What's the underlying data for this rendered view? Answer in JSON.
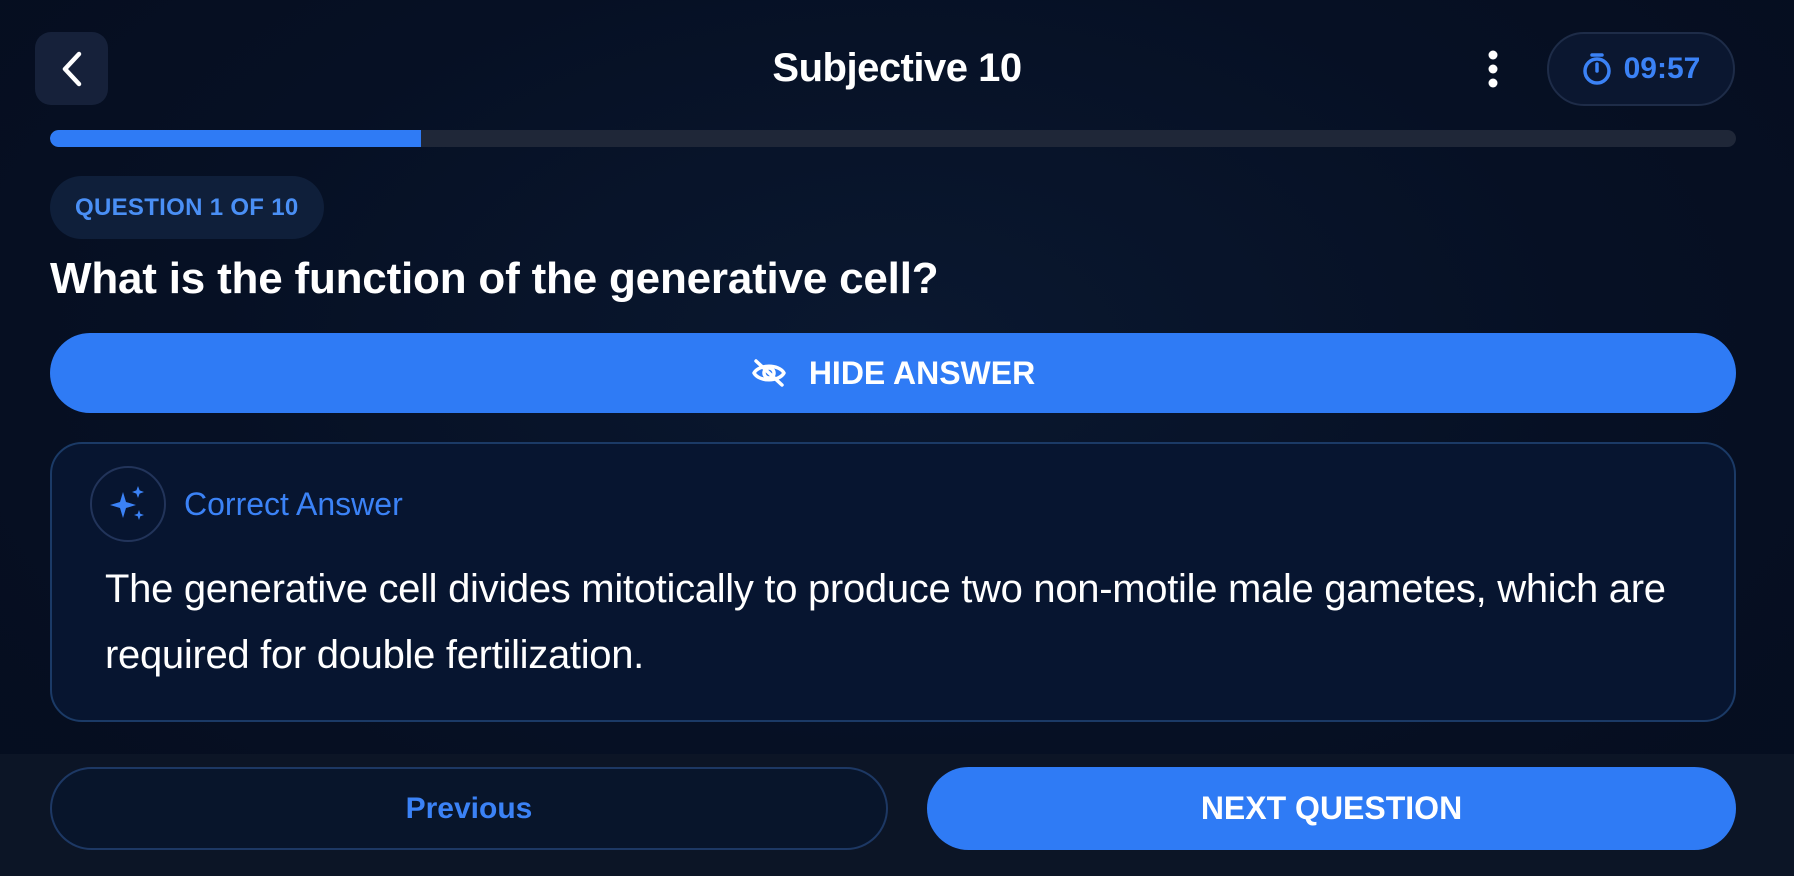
{
  "header": {
    "title": "Subjective 10",
    "timer": "09:57",
    "back_icon": "chevron-left-icon",
    "more_icon": "more-vertical-icon",
    "timer_icon": "stopwatch-icon"
  },
  "progress": {
    "fraction": 0.22
  },
  "question": {
    "badge": "QUESTION 1 OF 10",
    "text": "What is the function of the generative cell?"
  },
  "hide_answer": {
    "label": "HIDE ANSWER",
    "icon": "eye-off-icon"
  },
  "answer": {
    "label": "Correct Answer",
    "icon": "sparkles-icon",
    "text": "The generative cell divides mitotically to produce two non-motile male gametes, which are required for double fertilization."
  },
  "footer": {
    "previous_label": "Previous",
    "next_label": "NEXT QUESTION"
  },
  "colors": {
    "accent": "#2f7bf5",
    "background": "#061024",
    "accent_text": "#3b82f6"
  }
}
